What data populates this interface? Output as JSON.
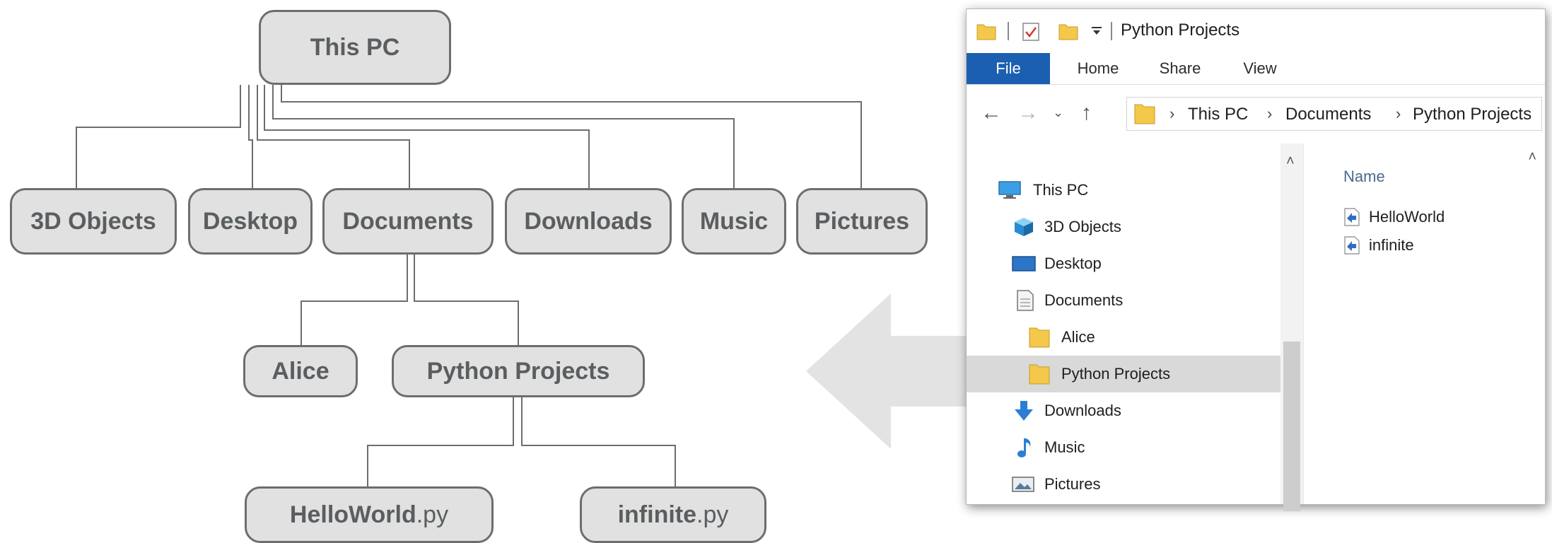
{
  "tree": {
    "root": "This PC",
    "level1": [
      "3D Objects",
      "Desktop",
      "Documents",
      "Downloads",
      "Music",
      "Pictures"
    ],
    "documents_children": [
      "Alice",
      "Python Projects"
    ],
    "project_files": [
      {
        "name": "HelloWorld",
        "ext": ".py"
      },
      {
        "name": "infinite",
        "ext": ".py"
      }
    ]
  },
  "explorer": {
    "title": "Python Projects",
    "tabs": [
      "File",
      "Home",
      "Share",
      "View"
    ],
    "breadcrumbs": [
      "This PC",
      "Documents",
      "Python Projects"
    ],
    "nav_items": [
      {
        "label": "This PC",
        "icon": "monitor-icon"
      },
      {
        "label": "3D Objects",
        "icon": "cube-icon"
      },
      {
        "label": "Desktop",
        "icon": "desktop-icon"
      },
      {
        "label": "Documents",
        "icon": "document-icon"
      },
      {
        "label": "Alice",
        "icon": "folder-icon"
      },
      {
        "label": "Python Projects",
        "icon": "folder-icon",
        "selected": true
      },
      {
        "label": "Downloads",
        "icon": "download-arrow-icon"
      },
      {
        "label": "Music",
        "icon": "music-note-icon"
      },
      {
        "label": "Pictures",
        "icon": "picture-icon"
      }
    ],
    "column_header": "Name",
    "files": [
      "HelloWorld",
      "infinite"
    ]
  },
  "colors": {
    "node_fill": "#e1e1e1",
    "node_border": "#6b6e70",
    "node_text": "#5a5e61",
    "file_tab": "#1b5fb0",
    "folder": "#f3c84b",
    "selection": "#d9d9d9"
  }
}
